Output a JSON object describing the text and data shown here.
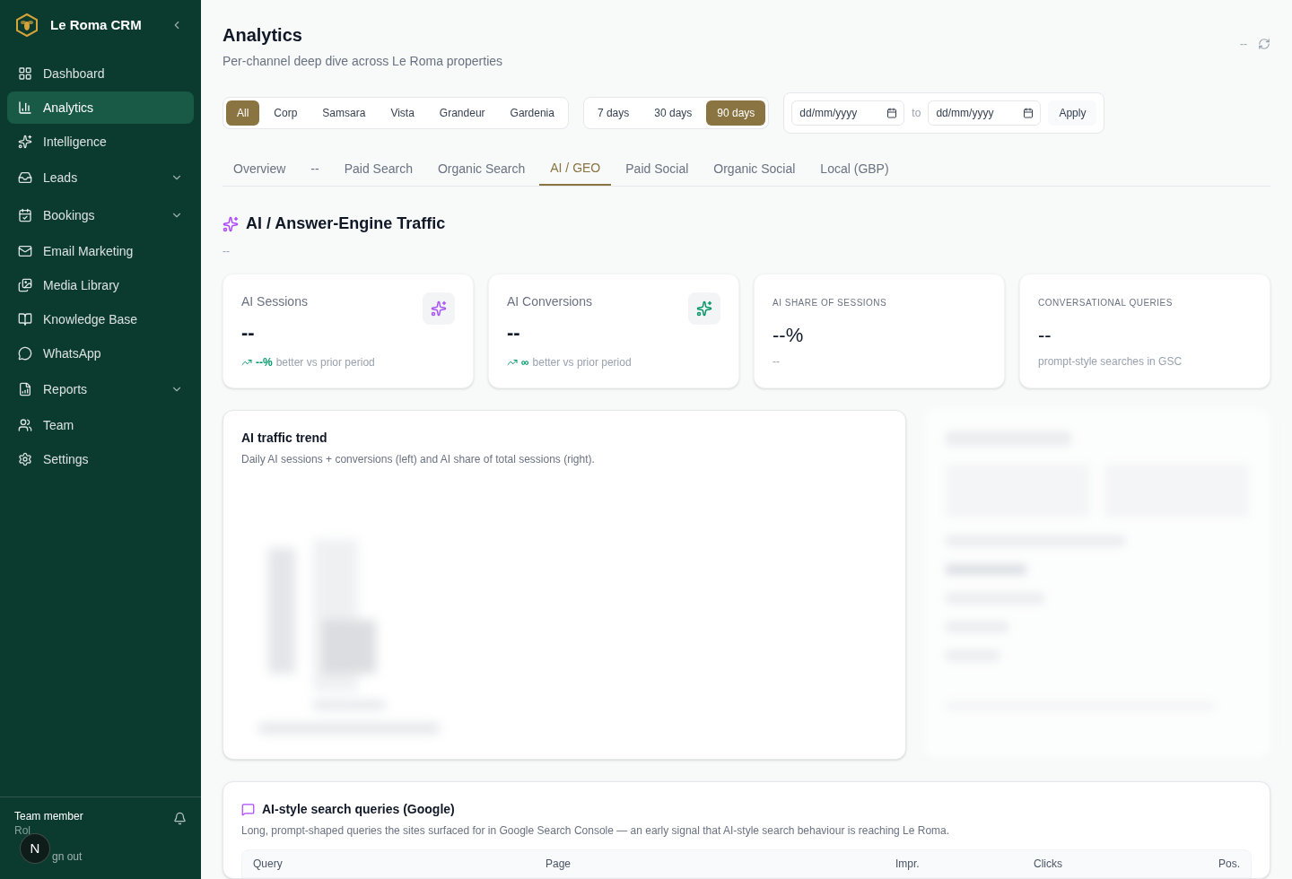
{
  "sidebar": {
    "brand": "Le Roma CRM",
    "items": [
      {
        "label": "Dashboard",
        "selected": false,
        "expandable": false
      },
      {
        "label": "Analytics",
        "selected": true,
        "expandable": false
      },
      {
        "label": "Intelligence",
        "selected": false,
        "expandable": false
      },
      {
        "label": "Leads",
        "selected": false,
        "expandable": true
      },
      {
        "label": "Bookings",
        "selected": false,
        "expandable": true
      },
      {
        "label": "Email Marketing",
        "selected": false,
        "expandable": false
      },
      {
        "label": "Media Library",
        "selected": false,
        "expandable": false
      },
      {
        "label": "Knowledge Base",
        "selected": false,
        "expandable": false
      },
      {
        "label": "WhatsApp",
        "selected": false,
        "expandable": false
      },
      {
        "label": "Reports",
        "selected": false,
        "expandable": true
      },
      {
        "label": "Team",
        "selected": false,
        "expandable": false
      },
      {
        "label": "Settings",
        "selected": false,
        "expandable": false
      }
    ],
    "user": {
      "name": "Team member",
      "role": "Rol",
      "avatar": "N",
      "signout": "gn out"
    }
  },
  "header": {
    "title": "Analytics",
    "subtitle": "Per-channel deep dive across Le Roma properties",
    "status": "--"
  },
  "properties": [
    {
      "label": "All",
      "selected": true
    },
    {
      "label": "Corp",
      "selected": false
    },
    {
      "label": "Samsara",
      "selected": false
    },
    {
      "label": "Vista",
      "selected": false
    },
    {
      "label": "Grandeur",
      "selected": false
    },
    {
      "label": "Gardenia",
      "selected": false
    }
  ],
  "ranges": [
    {
      "label": "7 days",
      "selected": false
    },
    {
      "label": "30 days",
      "selected": false
    },
    {
      "label": "90 days",
      "selected": true
    }
  ],
  "date_range": {
    "from_placeholder": "dd/mm/yyyy",
    "separator": "to",
    "to_placeholder": "dd/mm/yyyy",
    "apply": "Apply"
  },
  "tabs": [
    {
      "label": "Overview",
      "selected": false
    },
    {
      "label": "--",
      "selected": false
    },
    {
      "label": "Paid Search",
      "selected": false
    },
    {
      "label": "Organic Search",
      "selected": false
    },
    {
      "label": "AI / GEO",
      "selected": true
    },
    {
      "label": "Paid Social",
      "selected": false
    },
    {
      "label": "Organic Social",
      "selected": false
    },
    {
      "label": "Local (GBP)",
      "selected": false
    }
  ],
  "section": {
    "title": "AI / Answer-Engine Traffic",
    "subtitle": "--"
  },
  "kpis": [
    {
      "kind": "icon",
      "label": "AI Sessions",
      "value": "--",
      "delta": "--%",
      "note": "better vs prior period"
    },
    {
      "kind": "icon",
      "label": "AI Conversions",
      "value": "--",
      "delta": "∞",
      "note": "better vs prior period"
    },
    {
      "kind": "caps",
      "label": "AI SHARE OF SESSIONS",
      "value": "--%",
      "note": "--"
    },
    {
      "kind": "caps",
      "label": "CONVERSATIONAL QUERIES",
      "value": "--",
      "note": "prompt-style searches in GSC"
    }
  ],
  "trend": {
    "title": "AI traffic trend",
    "subtitle": "Daily AI sessions + conversions (left) and AI share of total sessions (right)."
  },
  "queries": {
    "title": "AI-style search queries (Google)",
    "subtitle": "Long, prompt-shaped queries the sites surfaced for in Google Search Console — an early signal that AI-style search behaviour is reaching Le Roma.",
    "columns": [
      "Query",
      "Page",
      "Impr.",
      "Clicks",
      "Pos."
    ]
  }
}
